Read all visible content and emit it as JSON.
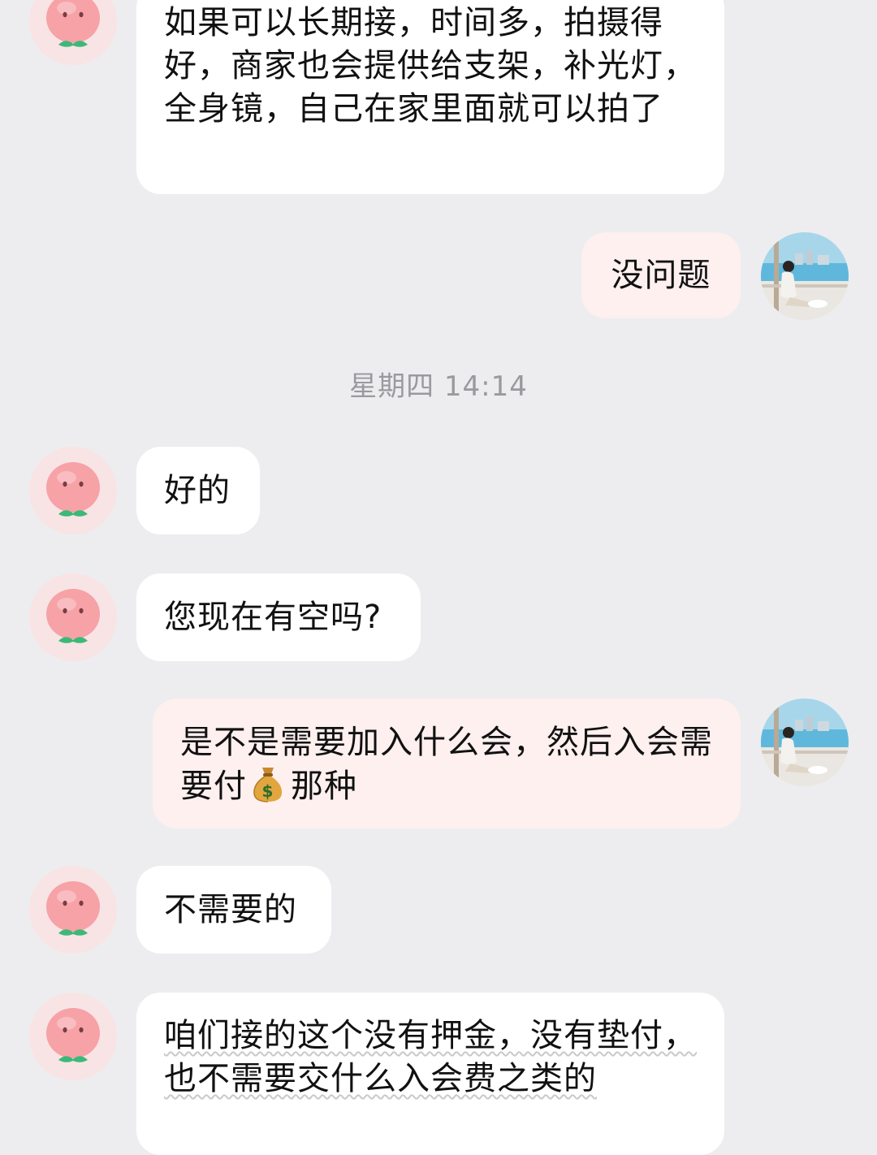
{
  "timestamp": "星期四 14:14",
  "messages": [
    {
      "side": "in",
      "text": "如果可以长期接，时间多，拍摄得好，商家也会提供给支架，补光灯，全身镜，自己在家里面就可以拍了"
    },
    {
      "side": "out",
      "text": "没问题"
    },
    {
      "side": "in",
      "text": "好的"
    },
    {
      "side": "in",
      "text": "您现在有空吗?"
    },
    {
      "side": "out",
      "text_before": "是不是需要加入什么会，然后入会需要付",
      "icon": "money-bag-icon",
      "text_after": "那种"
    },
    {
      "side": "in",
      "text": "不需要的"
    },
    {
      "side": "in",
      "text": "咱们接的这个没有押金，没有垫付，也不需要交什么入会费之类的"
    }
  ],
  "icons": {
    "sender_avatar": "peach-avatar-icon",
    "self_avatar": "photo-avatar-icon",
    "emoji": "money-bag-icon"
  },
  "colors": {
    "background": "#ededef",
    "incoming_bubble": "#ffffff",
    "outgoing_bubble": "#fdf0ef",
    "timestamp_text": "#9a9a9e",
    "peach": "#f6a3a8",
    "leaf": "#3cb878"
  }
}
